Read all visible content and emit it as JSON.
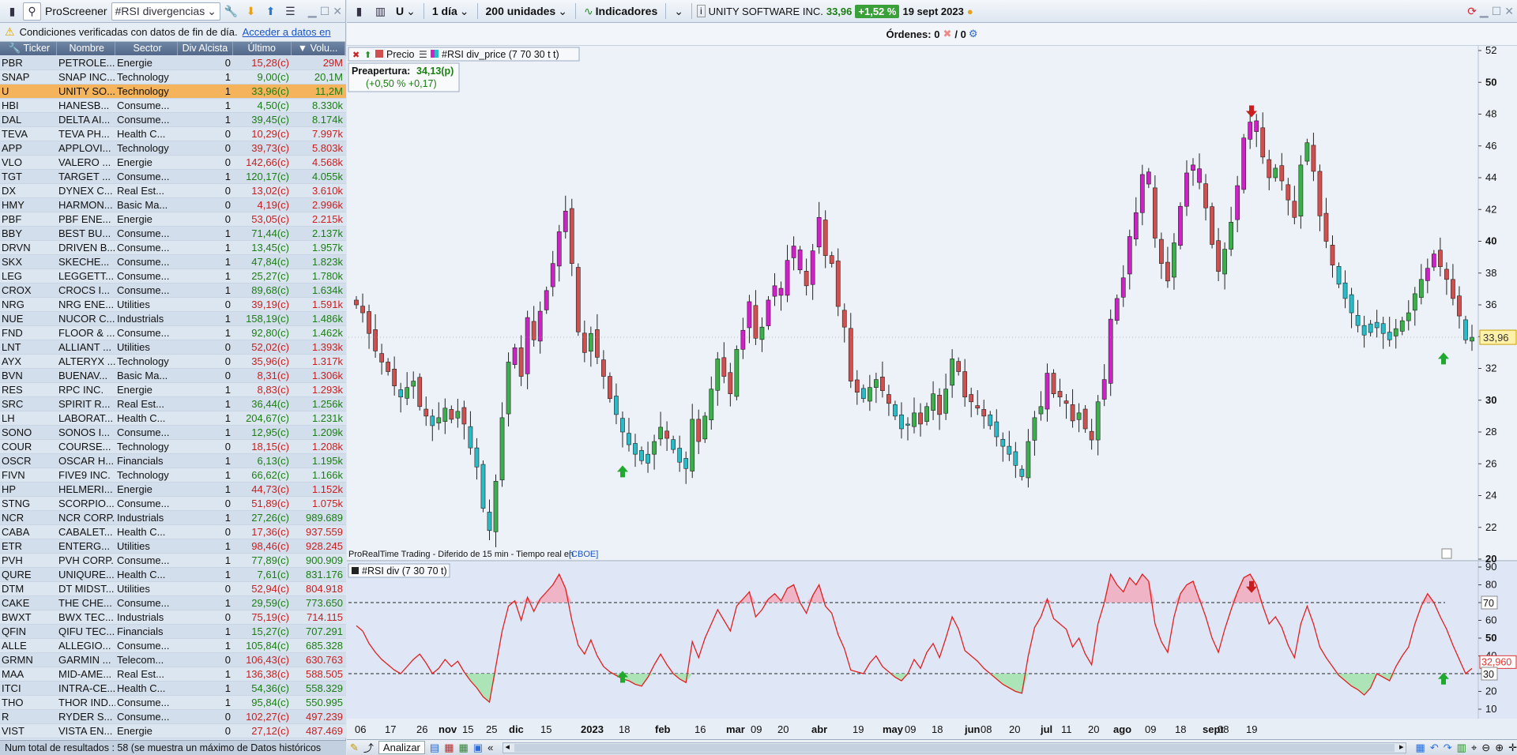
{
  "left_toolbar": {
    "app_label": "ProScreener",
    "screen_name": "#RSI divergencias"
  },
  "notice": {
    "text": "Condiciones verificadas con datos de fin de día.",
    "link": "Acceder a datos en"
  },
  "table": {
    "headers": [
      "Ticker",
      "Nombre",
      "Sector",
      "Div Alcista",
      "Último",
      "Volu..."
    ],
    "rows": [
      [
        "PBR",
        "PETROLE...",
        "Energie",
        "0",
        "15,28(c)",
        "29M",
        "dn"
      ],
      [
        "SNAP",
        "SNAP INC...",
        "Technology",
        "1",
        "9,00(c)",
        "20,1M",
        "up"
      ],
      [
        "U",
        "UNITY SO...",
        "Technology",
        "1",
        "33,96(c)",
        "11,2M",
        "up"
      ],
      [
        "HBI",
        "HANESB...",
        "Consume...",
        "1",
        "4,50(c)",
        "8.330k",
        "up"
      ],
      [
        "DAL",
        "DELTA AI...",
        "Consume...",
        "1",
        "39,45(c)",
        "8.174k",
        "up"
      ],
      [
        "TEVA",
        "TEVA PH...",
        "Health C...",
        "0",
        "10,29(c)",
        "7.997k",
        "dn"
      ],
      [
        "APP",
        "APPLOVI...",
        "Technology",
        "0",
        "39,73(c)",
        "5.803k",
        "dn"
      ],
      [
        "VLO",
        "VALERO ...",
        "Energie",
        "0",
        "142,66(c)",
        "4.568k",
        "dn"
      ],
      [
        "TGT",
        "TARGET ...",
        "Consume...",
        "1",
        "120,17(c)",
        "4.055k",
        "up"
      ],
      [
        "DX",
        "DYNEX C...",
        "Real Est...",
        "0",
        "13,02(c)",
        "3.610k",
        "dn"
      ],
      [
        "HMY",
        "HARMON...",
        "Basic Ma...",
        "0",
        "4,19(c)",
        "2.996k",
        "dn"
      ],
      [
        "PBF",
        "PBF ENE...",
        "Energie",
        "0",
        "53,05(c)",
        "2.215k",
        "dn"
      ],
      [
        "BBY",
        "BEST BU...",
        "Consume...",
        "1",
        "71,44(c)",
        "2.137k",
        "up"
      ],
      [
        "DRVN",
        "DRIVEN B...",
        "Consume...",
        "1",
        "13,45(c)",
        "1.957k",
        "up"
      ],
      [
        "SKX",
        "SKECHE...",
        "Consume...",
        "1",
        "47,84(c)",
        "1.823k",
        "up"
      ],
      [
        "LEG",
        "LEGGETT...",
        "Consume...",
        "1",
        "25,27(c)",
        "1.780k",
        "up"
      ],
      [
        "CROX",
        "CROCS I...",
        "Consume...",
        "1",
        "89,68(c)",
        "1.634k",
        "up"
      ],
      [
        "NRG",
        "NRG ENE...",
        "Utilities",
        "0",
        "39,19(c)",
        "1.591k",
        "dn"
      ],
      [
        "NUE",
        "NUCOR C...",
        "Industrials",
        "1",
        "158,19(c)",
        "1.486k",
        "up"
      ],
      [
        "FND",
        "FLOOR & ...",
        "Consume...",
        "1",
        "92,80(c)",
        "1.462k",
        "up"
      ],
      [
        "LNT",
        "ALLIANT ...",
        "Utilities",
        "0",
        "52,02(c)",
        "1.393k",
        "dn"
      ],
      [
        "AYX",
        "ALTERYX ...",
        "Technology",
        "0",
        "35,96(c)",
        "1.317k",
        "dn"
      ],
      [
        "BVN",
        "BUENAV...",
        "Basic Ma...",
        "0",
        "8,31(c)",
        "1.306k",
        "dn"
      ],
      [
        "RES",
        "RPC INC.",
        "Energie",
        "1",
        "8,83(c)",
        "1.293k",
        "dn"
      ],
      [
        "SRC",
        "SPIRIT R...",
        "Real Est...",
        "1",
        "36,44(c)",
        "1.256k",
        "up"
      ],
      [
        "LH",
        "LABORAT...",
        "Health C...",
        "1",
        "204,67(c)",
        "1.231k",
        "up"
      ],
      [
        "SONO",
        "SONOS I...",
        "Consume...",
        "1",
        "12,95(c)",
        "1.209k",
        "up"
      ],
      [
        "COUR",
        "COURSE...",
        "Technology",
        "0",
        "18,15(c)",
        "1.208k",
        "dn"
      ],
      [
        "OSCR",
        "OSCAR H...",
        "Financials",
        "1",
        "6,13(c)",
        "1.195k",
        "up"
      ],
      [
        "FIVN",
        "FIVE9 INC.",
        "Technology",
        "1",
        "66,62(c)",
        "1.166k",
        "up"
      ],
      [
        "HP",
        "HELMERI...",
        "Energie",
        "1",
        "44,73(c)",
        "1.152k",
        "dn"
      ],
      [
        "STNG",
        "SCORPIO...",
        "Consume...",
        "0",
        "51,89(c)",
        "1.075k",
        "dn"
      ],
      [
        "NCR",
        "NCR CORP.",
        "Industrials",
        "1",
        "27,26(c)",
        "989.689",
        "up"
      ],
      [
        "CABA",
        "CABALET...",
        "Health C...",
        "0",
        "17,36(c)",
        "937.559",
        "dn"
      ],
      [
        "ETR",
        "ENTERG...",
        "Utilities",
        "1",
        "98,46(c)",
        "928.245",
        "dn"
      ],
      [
        "PVH",
        "PVH CORP.",
        "Consume...",
        "1",
        "77,89(c)",
        "900.909",
        "up"
      ],
      [
        "QURE",
        "UNIQURE...",
        "Health C...",
        "1",
        "7,61(c)",
        "831.176",
        "up"
      ],
      [
        "DTM",
        "DT MIDST...",
        "Utilities",
        "0",
        "52,94(c)",
        "804.918",
        "dn"
      ],
      [
        "CAKE",
        "THE CHE...",
        "Consume...",
        "1",
        "29,59(c)",
        "773.650",
        "up"
      ],
      [
        "BWXT",
        "BWX TEC...",
        "Industrials",
        "0",
        "75,19(c)",
        "714.115",
        "dn"
      ],
      [
        "QFIN",
        "QIFU TEC...",
        "Financials",
        "1",
        "15,27(c)",
        "707.291",
        "up"
      ],
      [
        "ALLE",
        "ALLEGIO...",
        "Consume...",
        "1",
        "105,84(c)",
        "685.328",
        "up"
      ],
      [
        "GRMN",
        "GARMIN ...",
        "Telecom...",
        "0",
        "106,43(c)",
        "630.763",
        "dn"
      ],
      [
        "MAA",
        "MID-AME...",
        "Real Est...",
        "1",
        "136,38(c)",
        "588.505",
        "dn"
      ],
      [
        "ITCI",
        "INTRA-CE...",
        "Health C...",
        "1",
        "54,36(c)",
        "558.329",
        "up"
      ],
      [
        "THO",
        "THOR IND...",
        "Consume...",
        "1",
        "95,84(c)",
        "550.995",
        "up"
      ],
      [
        "R",
        "RYDER S...",
        "Consume...",
        "0",
        "102,27(c)",
        "497.239",
        "dn"
      ],
      [
        "VIST",
        "VISTA EN...",
        "Energie",
        "0",
        "27,12(c)",
        "487.469",
        "dn"
      ]
    ],
    "selected_ticker": "U"
  },
  "left_status": "Num total de resultados : 58 (se muestra un máximo de Datos históricos",
  "right_toolbar": {
    "symbol": "U",
    "interval": "1 día",
    "units": "200 unidades",
    "indicators": "Indicadores",
    "company": "UNITY SOFTWARE INC.",
    "price": "33,96",
    "change": "+1,52 %",
    "date": "19 sept 2023"
  },
  "orders": {
    "label": "Órdenes: 0",
    "sep": "/ 0"
  },
  "price_panel": {
    "tabs": [
      "Precio",
      "#RSI div_price (7 70 30 t t)"
    ],
    "preopen_label": "Preapertura:",
    "preopen_value": "34,13(p)",
    "preopen_change": "(+0,50 %  +0,17)",
    "footer": "ProRealTime Trading - Diferido de 15 min - Tiempo real en",
    "footer_link": "[CBOE]",
    "last_label": "33,96"
  },
  "rsi_panel": {
    "title": "#RSI div (7 30 70 t)",
    "last_label": "32,960",
    "levels": [
      "70",
      "30"
    ]
  },
  "bottom_bar": {
    "analizar": "Analizar"
  },
  "colors": {
    "selected_row": "#f5b45b",
    "up": "#1c7d14",
    "down": "#c81e1e",
    "rsi_line": "#e02020"
  },
  "chart_data": {
    "type": "candlestick",
    "title": "",
    "price_ylim": [
      20,
      52
    ],
    "price_ticks": [
      20,
      22,
      24,
      26,
      28,
      30,
      32,
      34,
      36,
      38,
      40,
      42,
      44,
      46,
      48,
      50,
      52
    ],
    "rsi_ylim": [
      10,
      90
    ],
    "rsi_ticks": [
      10,
      20,
      30,
      40,
      50,
      60,
      70,
      80,
      90
    ],
    "x_tick_labels": [
      "06",
      "17",
      "26",
      "nov",
      "15",
      "25",
      "dic",
      "15",
      "2023",
      "18",
      "feb",
      "16",
      "mar",
      "09",
      "20",
      "abr",
      "19",
      "may",
      "09",
      "18",
      "jun",
      "08",
      "20",
      "jul",
      "11",
      "20",
      "ago",
      "09",
      "18",
      "sept",
      "08",
      "19"
    ],
    "bold_month_labels": [
      "nov",
      "dic",
      "2023",
      "feb",
      "mar",
      "abr",
      "may",
      "jun",
      "jul",
      "ago",
      "sept"
    ],
    "close_series": [
      36.0,
      35.5,
      34.2,
      33.1,
      32.4,
      31.8,
      30.9,
      30.2,
      30.8,
      31.2,
      29.6,
      29.0,
      28.4,
      28.9,
      29.5,
      28.8,
      29.3,
      28.5,
      27.0,
      25.8,
      23.2,
      21.8,
      24.9,
      28.9,
      32.4,
      33.3,
      31.5,
      35.2,
      33.8,
      35.6,
      36.9,
      38.6,
      40.6,
      41.9,
      38.6,
      34.3,
      33.0,
      34.2,
      32.7,
      31.5,
      30.1,
      29.1,
      28.0,
      27.2,
      26.6,
      26.2,
      26.6,
      27.4,
      28.3,
      27.6,
      26.9,
      26.1,
      25.7,
      28.8,
      27.4,
      29.0,
      30.7,
      32.6,
      31.5,
      30.4,
      33.2,
      34.4,
      36.2,
      33.9,
      34.6,
      36.3,
      37.2,
      36.6,
      38.8,
      39.7,
      38.2,
      37.2,
      39.4,
      41.5,
      39.1,
      38.6,
      35.9,
      34.6,
      31.2,
      30.5,
      30.1,
      30.8,
      31.3,
      30.6,
      29.8,
      29.0,
      28.2,
      28.5,
      29.2,
      28.5,
      29.6,
      30.4,
      29.1,
      30.7,
      32.6,
      31.8,
      30.2,
      29.9,
      29.5,
      29.0,
      28.4,
      27.7,
      27.1,
      26.6,
      25.9,
      25.2,
      27.4,
      28.9,
      29.6,
      31.7,
      30.4,
      30.2,
      29.8,
      28.7,
      29.2,
      28.2,
      27.5,
      29.9,
      31.3,
      35.1,
      36.4,
      37.7,
      40.3,
      41.8,
      44.2,
      43.6,
      40.2,
      38.6,
      37.5,
      39.9,
      42.2,
      44.3,
      44.8,
      43.7,
      42.1,
      39.8,
      38.1,
      39.5,
      41.2,
      43.5,
      46.5,
      47.5,
      46.9,
      45.3,
      44.0,
      44.6,
      43.8,
      42.6,
      41.5,
      44.8,
      46.2,
      44.4,
      41.6,
      40.0,
      38.5,
      37.3,
      36.4,
      35.5,
      34.7,
      34.1,
      34.8,
      34.9,
      34.2,
      33.8,
      34.5,
      35.0,
      35.5,
      36.7,
      37.6,
      38.3,
      39.2,
      38.4,
      37.6,
      36.4,
      35.3,
      33.8,
      33.96
    ],
    "rsi_series": [
      57,
      54,
      47,
      42,
      38,
      35,
      32,
      30,
      34,
      38,
      41,
      36,
      30,
      33,
      38,
      34,
      37,
      31,
      26,
      22,
      17,
      14,
      34,
      54,
      68,
      71,
      60,
      73,
      65,
      72,
      76,
      80,
      86,
      78,
      60,
      46,
      41,
      49,
      40,
      34,
      31,
      29,
      27,
      26,
      24,
      23,
      28,
      35,
      41,
      35,
      30,
      27,
      25,
      48,
      39,
      50,
      58,
      66,
      60,
      54,
      68,
      72,
      76,
      62,
      66,
      72,
      75,
      71,
      78,
      80,
      70,
      64,
      74,
      80,
      68,
      64,
      52,
      44,
      32,
      31,
      30,
      36,
      40,
      34,
      31,
      28,
      26,
      30,
      38,
      33,
      42,
      47,
      39,
      50,
      62,
      55,
      43,
      40,
      37,
      33,
      30,
      27,
      24,
      22,
      20,
      19,
      40,
      56,
      62,
      72,
      61,
      58,
      55,
      45,
      50,
      41,
      35,
      58,
      70,
      86,
      80,
      76,
      84,
      80,
      86,
      82,
      58,
      48,
      42,
      62,
      75,
      80,
      82,
      72,
      62,
      50,
      42,
      55,
      66,
      76,
      84,
      86,
      80,
      68,
      58,
      62,
      56,
      46,
      39,
      58,
      68,
      58,
      45,
      39,
      34,
      29,
      26,
      23,
      21,
      18,
      22,
      30,
      28,
      26,
      34,
      40,
      45,
      58,
      68,
      75,
      70,
      62,
      55,
      46,
      38,
      30,
      32.96
    ],
    "volume_col_header": "Volu...",
    "signals": [
      {
        "type": "bullish",
        "label": "up-arrow",
        "near": "2023"
      },
      {
        "type": "bearish",
        "label": "down-arrow",
        "near": "jul 20"
      },
      {
        "type": "bullish",
        "label": "up-arrow",
        "near": "sept 19"
      }
    ]
  }
}
